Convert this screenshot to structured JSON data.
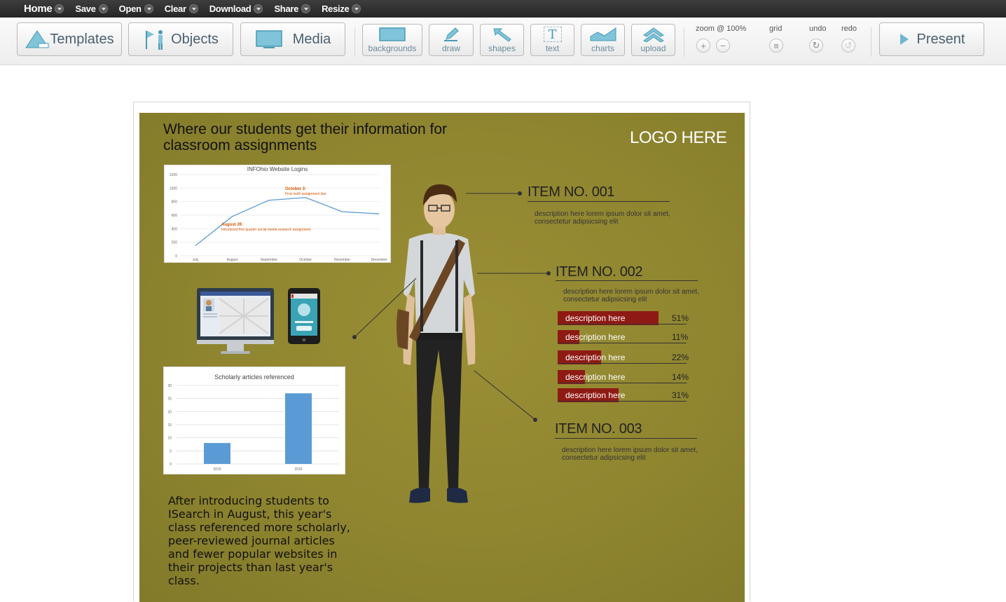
{
  "menu": {
    "items": [
      {
        "label": "Home"
      },
      {
        "label": "Save"
      },
      {
        "label": "Open"
      },
      {
        "label": "Clear"
      },
      {
        "label": "Download"
      },
      {
        "label": "Share"
      },
      {
        "label": "Resize"
      }
    ]
  },
  "toolbar": {
    "templates": "Templates",
    "objects": "Objects",
    "media": "Media",
    "tools": {
      "backgrounds": "backgrounds",
      "draw": "draw",
      "shapes": "shapes",
      "text": "text",
      "charts": "charts",
      "upload": "upload"
    },
    "zoom_label": "zoom @ 100%",
    "grid_label": "grid",
    "undo_label": "undo",
    "redo_label": "redo",
    "present": "Present",
    "accent_color": "#6b8a9a"
  },
  "slide": {
    "background_color": "#8f8530",
    "title": "Where our students get their information for classroom assignments",
    "logo": "LOGO HERE",
    "items": [
      {
        "title": "ITEM NO. 001",
        "desc": "description here lorem ipsum dolor sit amet, consectetur adipsicsing elit"
      },
      {
        "title": "ITEM NO. 002",
        "desc": "description here lorem ipsum dolor sit amet, consectetur adipsicsing elit"
      },
      {
        "title": "ITEM NO. 003",
        "desc": "description here lorem ipsum dolor sit amet, consectetur adipsicsing elit"
      }
    ],
    "bars": [
      {
        "label": "description here",
        "pct": "51%",
        "value": 0.51
      },
      {
        "label": "description here",
        "pct": "11%",
        "value": 0.11
      },
      {
        "label": "description here",
        "pct": "22%",
        "value": 0.22
      },
      {
        "label": "description here",
        "pct": "14%",
        "value": 0.14
      },
      {
        "label": "description here",
        "pct": "31%",
        "value": 0.31
      }
    ],
    "bar_color": "#8e1a14",
    "note": "After introducing students to ISearch in August, this year's class referenced more scholarly, peer-reviewed journal articles and fewer popular websites in their projects than last year's class."
  },
  "chart_data": [
    {
      "type": "line",
      "title": "INFOhio Website Logins",
      "categories": [
        "July",
        "August",
        "September",
        "October",
        "November",
        "December"
      ],
      "series": [
        {
          "values": [
            150,
            580,
            820,
            860,
            650,
            620
          ]
        }
      ],
      "ylim": [
        0,
        1200
      ],
      "yticks": [
        "0",
        "200",
        "400",
        "600",
        "800",
        "1000",
        "1200"
      ],
      "annotations": [
        {
          "label": "October 3:",
          "text": "First math assignment due"
        },
        {
          "label": "August 26:",
          "text": "Introduced first quarter social media research assignment"
        }
      ],
      "color": "#5b9bd5"
    },
    {
      "type": "bar",
      "title": "Scholarly articles referenced",
      "categories": [
        "2015",
        "2016"
      ],
      "values": [
        8,
        27
      ],
      "ylim": [
        0,
        30
      ],
      "yticks": [
        "0",
        "5",
        "10",
        "15",
        "20",
        "25",
        "30"
      ],
      "color": "#5b9bd5"
    }
  ]
}
